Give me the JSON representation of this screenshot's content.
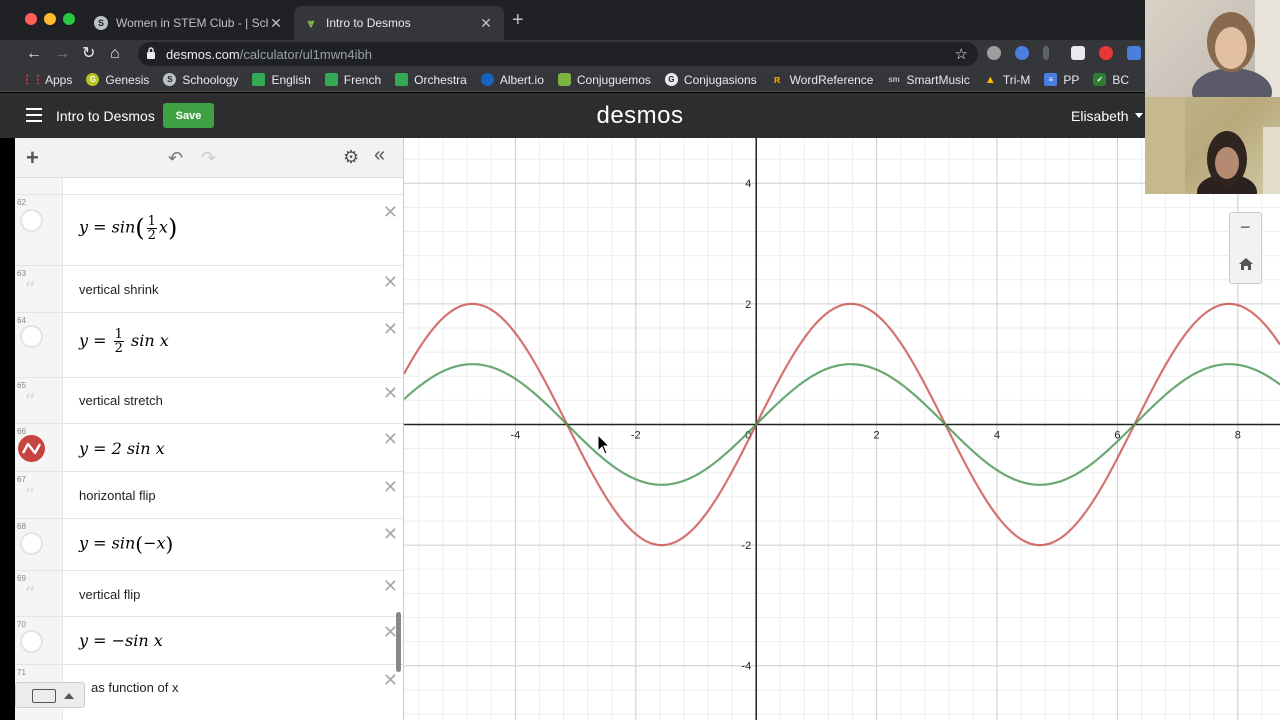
{
  "browser": {
    "tabs": [
      {
        "label": "Women in STEM Club - | Scho",
        "active": false
      },
      {
        "label": "Intro to Desmos",
        "active": true
      }
    ],
    "url_domain": "desmos.com",
    "url_path": "/calculator/ul1mwn4ibh",
    "bookmarks": [
      "Apps",
      "Genesis",
      "Schoology",
      "English",
      "French",
      "Orchestra",
      "Albert.io",
      "Conjuguemos",
      "Conjugasions",
      "WordReference",
      "SmartMusic",
      "Tri-M",
      "PP",
      "BC"
    ]
  },
  "header": {
    "title": "Intro to Desmos",
    "save_label": "Save",
    "logo": "desmos",
    "user": "Elisabeth"
  },
  "expressions": [
    {
      "num": "62",
      "kind": "math"
    },
    {
      "num": "63",
      "kind": "note",
      "text": "vertical shrink"
    },
    {
      "num": "64",
      "kind": "math"
    },
    {
      "num": "65",
      "kind": "note",
      "text": "vertical stretch"
    },
    {
      "num": "66",
      "kind": "math"
    },
    {
      "num": "67",
      "kind": "note",
      "text": "horizontal flip"
    },
    {
      "num": "68",
      "kind": "math"
    },
    {
      "num": "69",
      "kind": "note",
      "text": "vertical flip"
    },
    {
      "num": "70",
      "kind": "math"
    },
    {
      "num": "71",
      "kind": "note",
      "text": "as function of x"
    }
  ],
  "math": {
    "e62_prefix": "y = sin",
    "e62_var": "x",
    "frac_num": "1",
    "frac_den": "2",
    "e64_prefix": "y = ",
    "e64_suffix": "sin x",
    "e66": "y = 2 sin x",
    "e68_prefix": "y = sin",
    "e68_arg": "−x",
    "e70": "y = −sin x"
  },
  "icons": {
    "add": "plus-icon",
    "undo": "undo-icon",
    "redo": "redo-icon",
    "settings": "gear-icon",
    "collapse": "double-chevron-left-icon",
    "delete": "close-icon",
    "keyboard": "keyboard-icon",
    "zoom_out": "minus-icon",
    "home": "home-icon"
  },
  "chart_data": {
    "type": "line",
    "xlim": [
      -5.85,
      8.7
    ],
    "ylim": [
      -4.9,
      4.75
    ],
    "x_ticks": [
      "-4",
      "-2",
      "0",
      "2",
      "4",
      "6",
      "8"
    ],
    "y_ticks": [
      "4",
      "2",
      "-2",
      "-4"
    ],
    "grid": true,
    "series": [
      {
        "expr": "y = 2 sin x",
        "color": "#c74440",
        "amplitude": 2
      },
      {
        "expr": "y = sin x",
        "color": "#388c46",
        "amplitude": 1
      }
    ]
  },
  "colors": {
    "save": "#3fa144",
    "red_curve": "#c74440",
    "green_curve": "#388c46"
  }
}
